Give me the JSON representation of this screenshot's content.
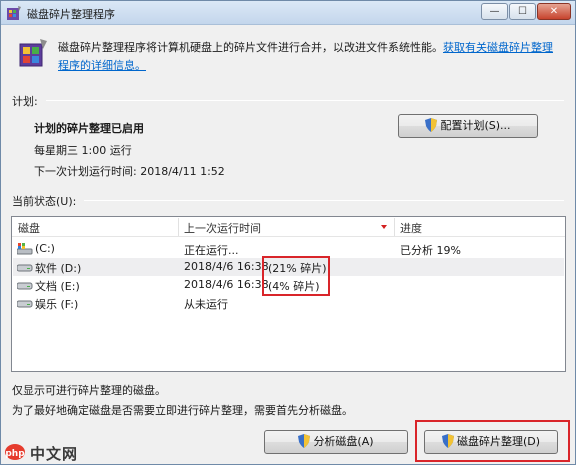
{
  "window": {
    "title": "磁盘碎片整理程序",
    "minimize": "—",
    "maximize": "☐",
    "close": "✕"
  },
  "intro": {
    "text": "磁盘碎片整理程序将计算机硬盘上的碎片文件进行合并，以改进文件系统性能。",
    "link": "获取有关磁盘碎片整理程序的详细信息。"
  },
  "schedule": {
    "group_label": "计划:",
    "status": "计划的碎片整理已启用",
    "frequency": "每星期三  1:00 运行",
    "next_run": "下一次计划运行时间: 2018/4/11 1:52",
    "configure_button": "配置计划(S)..."
  },
  "current_status": {
    "group_label": "当前状态(U):",
    "columns": [
      "磁盘",
      "上一次运行时间",
      "进度"
    ],
    "rows": [
      {
        "disk": "(C:)",
        "last_run": "正在运行...",
        "progress": "已分析 19%",
        "icon": "system-drive-icon"
      },
      {
        "disk": "软件 (D:)",
        "last_run": "2018/4/6 16:38",
        "progress": "(21% 碎片)",
        "icon": "hard-drive-icon"
      },
      {
        "disk": "文档 (E:)",
        "last_run": "2018/4/6 16:38",
        "progress": "(4% 碎片)",
        "icon": "hard-drive-icon"
      },
      {
        "disk": "娱乐 (F:)",
        "last_run": "从未运行",
        "progress": "",
        "icon": "hard-drive-icon"
      }
    ]
  },
  "notes": {
    "line1": "仅显示可进行碎片整理的磁盘。",
    "line2": "为了最好地确定磁盘是否需要立即进行碎片整理，需要首先分析磁盘。"
  },
  "buttons": {
    "analyze": "分析磁盘(A)",
    "defrag": "磁盘碎片整理(D)"
  },
  "watermark": {
    "text": "中文网"
  },
  "colors": {
    "link": "#0066cc",
    "highlight": "#d9252a"
  }
}
